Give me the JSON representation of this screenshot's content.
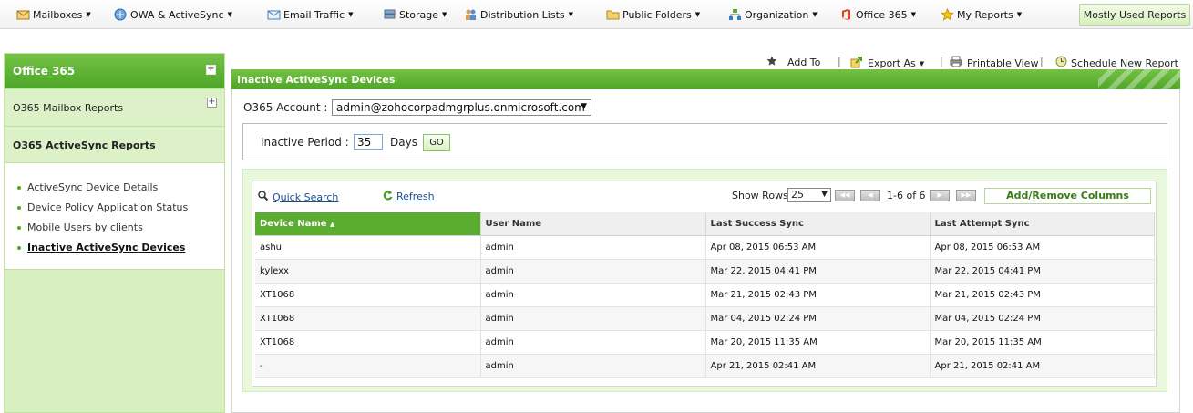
{
  "topbar": {
    "menus": [
      {
        "label": "Mailboxes",
        "icon": "mailbox-icon"
      },
      {
        "label": "OWA & ActiveSync",
        "icon": "owa-icon"
      },
      {
        "label": "Email Traffic",
        "icon": "email-icon"
      },
      {
        "label": "Storage",
        "icon": "storage-icon"
      },
      {
        "label": "Distribution Lists",
        "icon": "people-icon"
      },
      {
        "label": "Public Folders",
        "icon": "folder-icon"
      },
      {
        "label": "Organization",
        "icon": "org-chart-icon"
      },
      {
        "label": "Office 365",
        "icon": "office365-icon"
      },
      {
        "label": "My Reports",
        "icon": "star-icon"
      }
    ],
    "mostly_used": "Mostly Used Reports"
  },
  "sidebar": {
    "title": "Office 365",
    "sections": [
      {
        "label": "O365 Mailbox Reports"
      },
      {
        "label": "O365 ActiveSync Reports"
      }
    ],
    "items": [
      {
        "label": "ActiveSync Device Details"
      },
      {
        "label": "Device Policy Application Status"
      },
      {
        "label": "Mobile Users by clients"
      },
      {
        "label": "Inactive ActiveSync Devices"
      }
    ]
  },
  "toolbar": {
    "add_to": "Add To",
    "export_as": "Export As",
    "printable_view": "Printable View",
    "schedule": "Schedule New Report",
    "separator": "|"
  },
  "report": {
    "title": "Inactive ActiveSync Devices",
    "account_label": "O365 Account :",
    "account_value": "admin@zohocorpadmgrplus.onmicrosoft.com",
    "period_label": "Inactive Period :",
    "period_value": "35",
    "days_label": "Days",
    "go_label": "GO"
  },
  "grid": {
    "quick_search": "Quick Search",
    "refresh": "Refresh",
    "show_rows_label": "Show Rows",
    "rows_value": "25",
    "pager_text": "1-6 of 6",
    "add_remove": "Add/Remove Columns",
    "columns": [
      "Device Name",
      "User Name",
      "Last Success Sync",
      "Last Attempt Sync"
    ],
    "sort_indicator": "▲",
    "rows": [
      [
        "ashu",
        "admin",
        "Apr 08, 2015 06:53 AM",
        "Apr 08, 2015 06:53 AM"
      ],
      [
        "kylexx",
        "admin",
        "Mar 22, 2015 04:41 PM",
        "Mar 22, 2015 04:41 PM"
      ],
      [
        "XT1068",
        "admin",
        "Mar 21, 2015 02:43 PM",
        "Mar 21, 2015 02:43 PM"
      ],
      [
        "XT1068",
        "admin",
        "Mar 04, 2015 02:24 PM",
        "Mar 04, 2015 02:24 PM"
      ],
      [
        "XT1068",
        "admin",
        "Mar 20, 2015 11:35 AM",
        "Mar 20, 2015 11:35 AM"
      ],
      [
        "-",
        "admin",
        "Apr 21, 2015 02:41 AM",
        "Apr 21, 2015 02:41 AM"
      ]
    ]
  },
  "colors": {
    "brand_green": "#4ea628",
    "sidebar_bg": "#d8f0bf",
    "link_blue": "#1a4e8a"
  }
}
